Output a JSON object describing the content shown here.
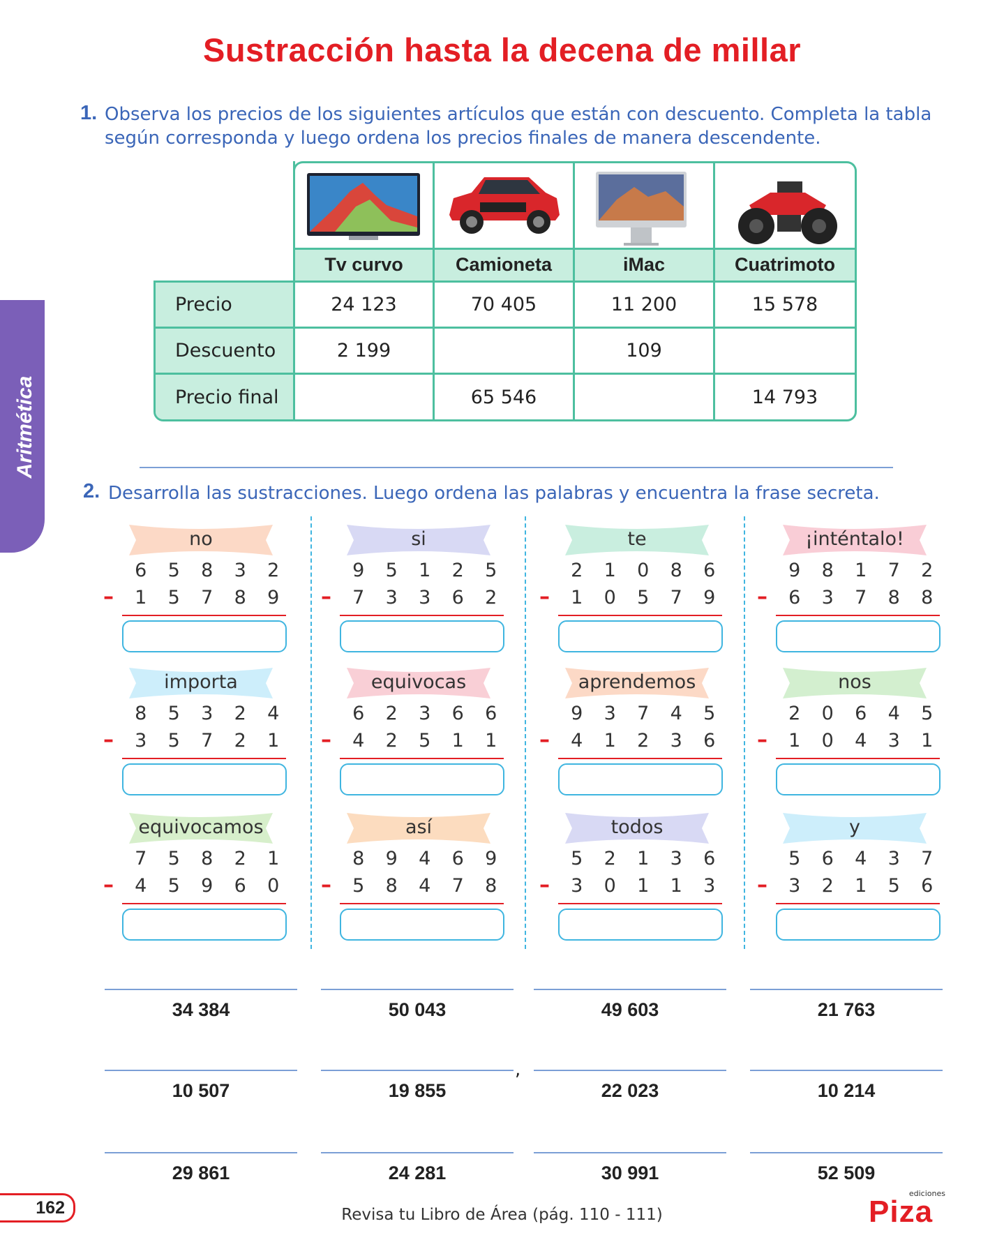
{
  "title": "Sustracción hasta la decena de millar",
  "side_tab": "Aritmética",
  "q1": {
    "number": "1.",
    "text_line1": "Observa los precios de los siguientes artículos que están con descuento. Completa la tabla",
    "text_line2": "según corresponda y luego ordena los precios finales de manera descendente."
  },
  "table": {
    "columns": [
      "Tv curvo",
      "Camioneta",
      "iMac",
      "Cuatrimoto"
    ],
    "rows": [
      {
        "label": "Precio",
        "values": [
          "24 123",
          "70 405",
          "11 200",
          "15 578"
        ]
      },
      {
        "label": "Descuento",
        "values": [
          "2 199",
          "",
          "109",
          ""
        ]
      },
      {
        "label": "Precio final",
        "values": [
          "",
          "65 546",
          "",
          "14 793"
        ]
      }
    ]
  },
  "q2": {
    "number": "2.",
    "text": "Desarrolla las sustracciones. Luego ordena las palabras y encuentra la frase secreta."
  },
  "exercises": [
    {
      "word": "no",
      "color": "#fcd9c6",
      "top": [
        "6",
        "5",
        "8",
        "3",
        "2"
      ],
      "bottom": [
        "1",
        "5",
        "7",
        "8",
        "9"
      ]
    },
    {
      "word": "si",
      "color": "#d8d9f4",
      "top": [
        "9",
        "5",
        "1",
        "2",
        "5"
      ],
      "bottom": [
        "7",
        "3",
        "3",
        "6",
        "2"
      ]
    },
    {
      "word": "te",
      "color": "#c9eedf",
      "top": [
        "2",
        "1",
        "0",
        "8",
        "6"
      ],
      "bottom": [
        "1",
        "0",
        "5",
        "7",
        "9"
      ]
    },
    {
      "word": "¡inténtalo!",
      "color": "#f9cdd6",
      "top": [
        "9",
        "8",
        "1",
        "7",
        "2"
      ],
      "bottom": [
        "6",
        "3",
        "7",
        "8",
        "8"
      ]
    },
    {
      "word": "importa",
      "color": "#cdeefb",
      "top": [
        "8",
        "5",
        "3",
        "2",
        "4"
      ],
      "bottom": [
        "3",
        "5",
        "7",
        "2",
        "1"
      ]
    },
    {
      "word": "equivocas",
      "color": "#f9cfd6",
      "top": [
        "6",
        "2",
        "3",
        "6",
        "6"
      ],
      "bottom": [
        "4",
        "2",
        "5",
        "1",
        "1"
      ]
    },
    {
      "word": "aprendemos",
      "color": "#fcd9c6",
      "top": [
        "9",
        "3",
        "7",
        "4",
        "5"
      ],
      "bottom": [
        "4",
        "1",
        "2",
        "3",
        "6"
      ]
    },
    {
      "word": "nos",
      "color": "#d3efcf",
      "top": [
        "2",
        "0",
        "6",
        "4",
        "5"
      ],
      "bottom": [
        "1",
        "0",
        "4",
        "3",
        "1"
      ]
    },
    {
      "word": "equivocamos",
      "color": "#d7efcb",
      "top": [
        "7",
        "5",
        "8",
        "2",
        "1"
      ],
      "bottom": [
        "4",
        "5",
        "9",
        "6",
        "0"
      ]
    },
    {
      "word": "así",
      "color": "#fcdcbf",
      "top": [
        "8",
        "9",
        "4",
        "6",
        "9"
      ],
      "bottom": [
        "5",
        "8",
        "4",
        "7",
        "8"
      ]
    },
    {
      "word": "todos",
      "color": "#d8d9f4",
      "top": [
        "5",
        "2",
        "1",
        "3",
        "6"
      ],
      "bottom": [
        "3",
        "0",
        "1",
        "1",
        "3"
      ]
    },
    {
      "word": "y",
      "color": "#cdeefb",
      "top": [
        "5",
        "6",
        "4",
        "3",
        "7"
      ],
      "bottom": [
        "3",
        "2",
        "1",
        "5",
        "6"
      ]
    }
  ],
  "results": [
    [
      "34 384",
      "50 043",
      "49 603",
      "21 763"
    ],
    [
      "10 507",
      "19 855",
      "22 023",
      "10 214"
    ],
    [
      "29 861",
      "24 281",
      "30 991",
      "52 509"
    ]
  ],
  "results_comma": ",",
  "page_number": "162",
  "footer": "Revisa tu Libro de Área (pág. 110 - 111)",
  "logo": {
    "small": "ediciones",
    "big": "Piza"
  },
  "colors": {
    "title": "#e31e24",
    "question": "#3b66b8",
    "table_border": "#4dbf9f",
    "table_fill": "#c8eedf",
    "side_tab": "#7b5fb8",
    "answer_box": "#3fb5e0"
  }
}
